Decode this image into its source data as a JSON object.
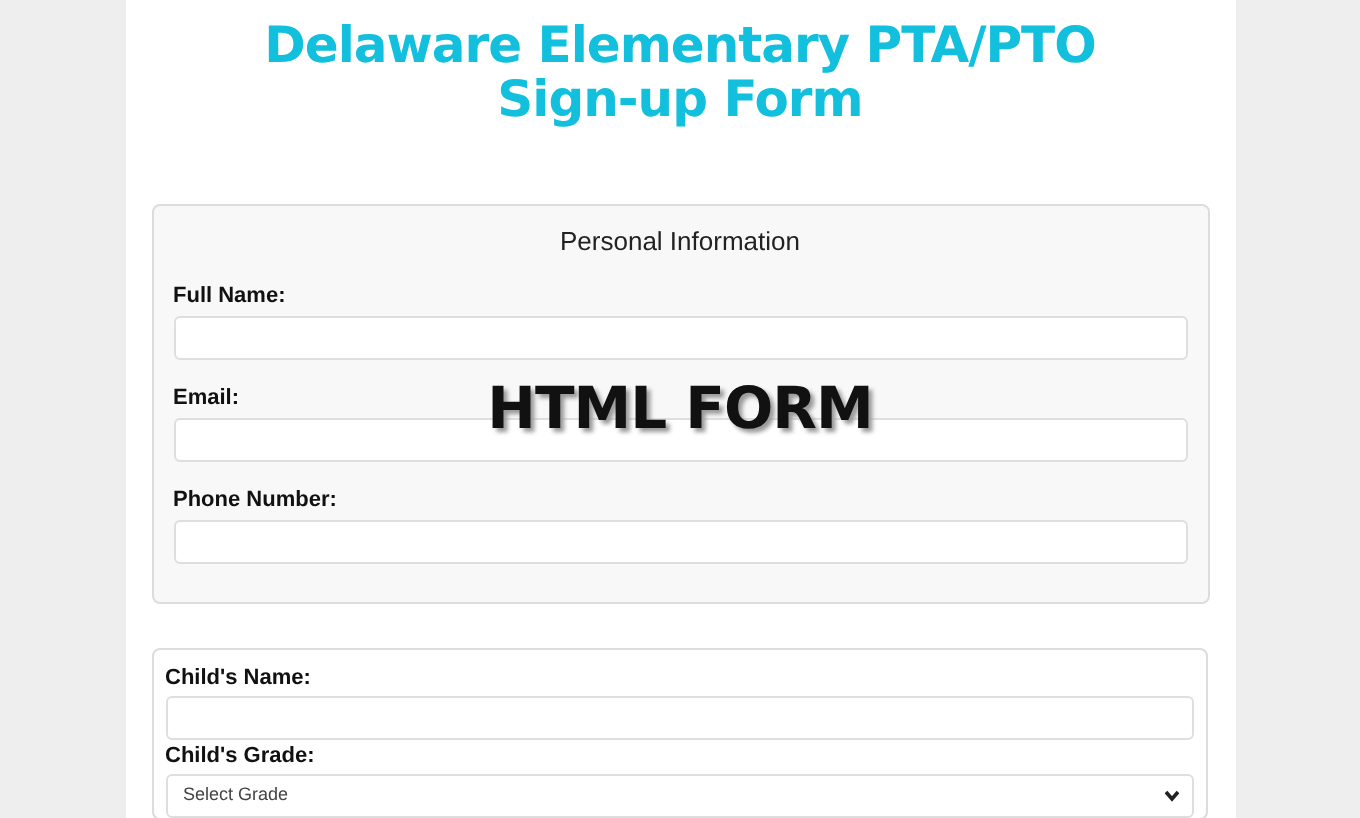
{
  "title": "Delaware Elementary PTA/PTO Sign-up Form",
  "personal_section": {
    "heading": "Personal Information",
    "fields": [
      {
        "label": "Full Name:",
        "kind": "text"
      },
      {
        "label": "Email:",
        "kind": "text"
      },
      {
        "label": "Phone Number:",
        "kind": "text"
      }
    ]
  },
  "child_section": {
    "fields": [
      {
        "label": "Child's Name:",
        "kind": "text"
      },
      {
        "label": "Child's Grade:",
        "kind": "select",
        "value": "Select Grade"
      }
    ]
  },
  "overlay_caption": "HTML FORM"
}
